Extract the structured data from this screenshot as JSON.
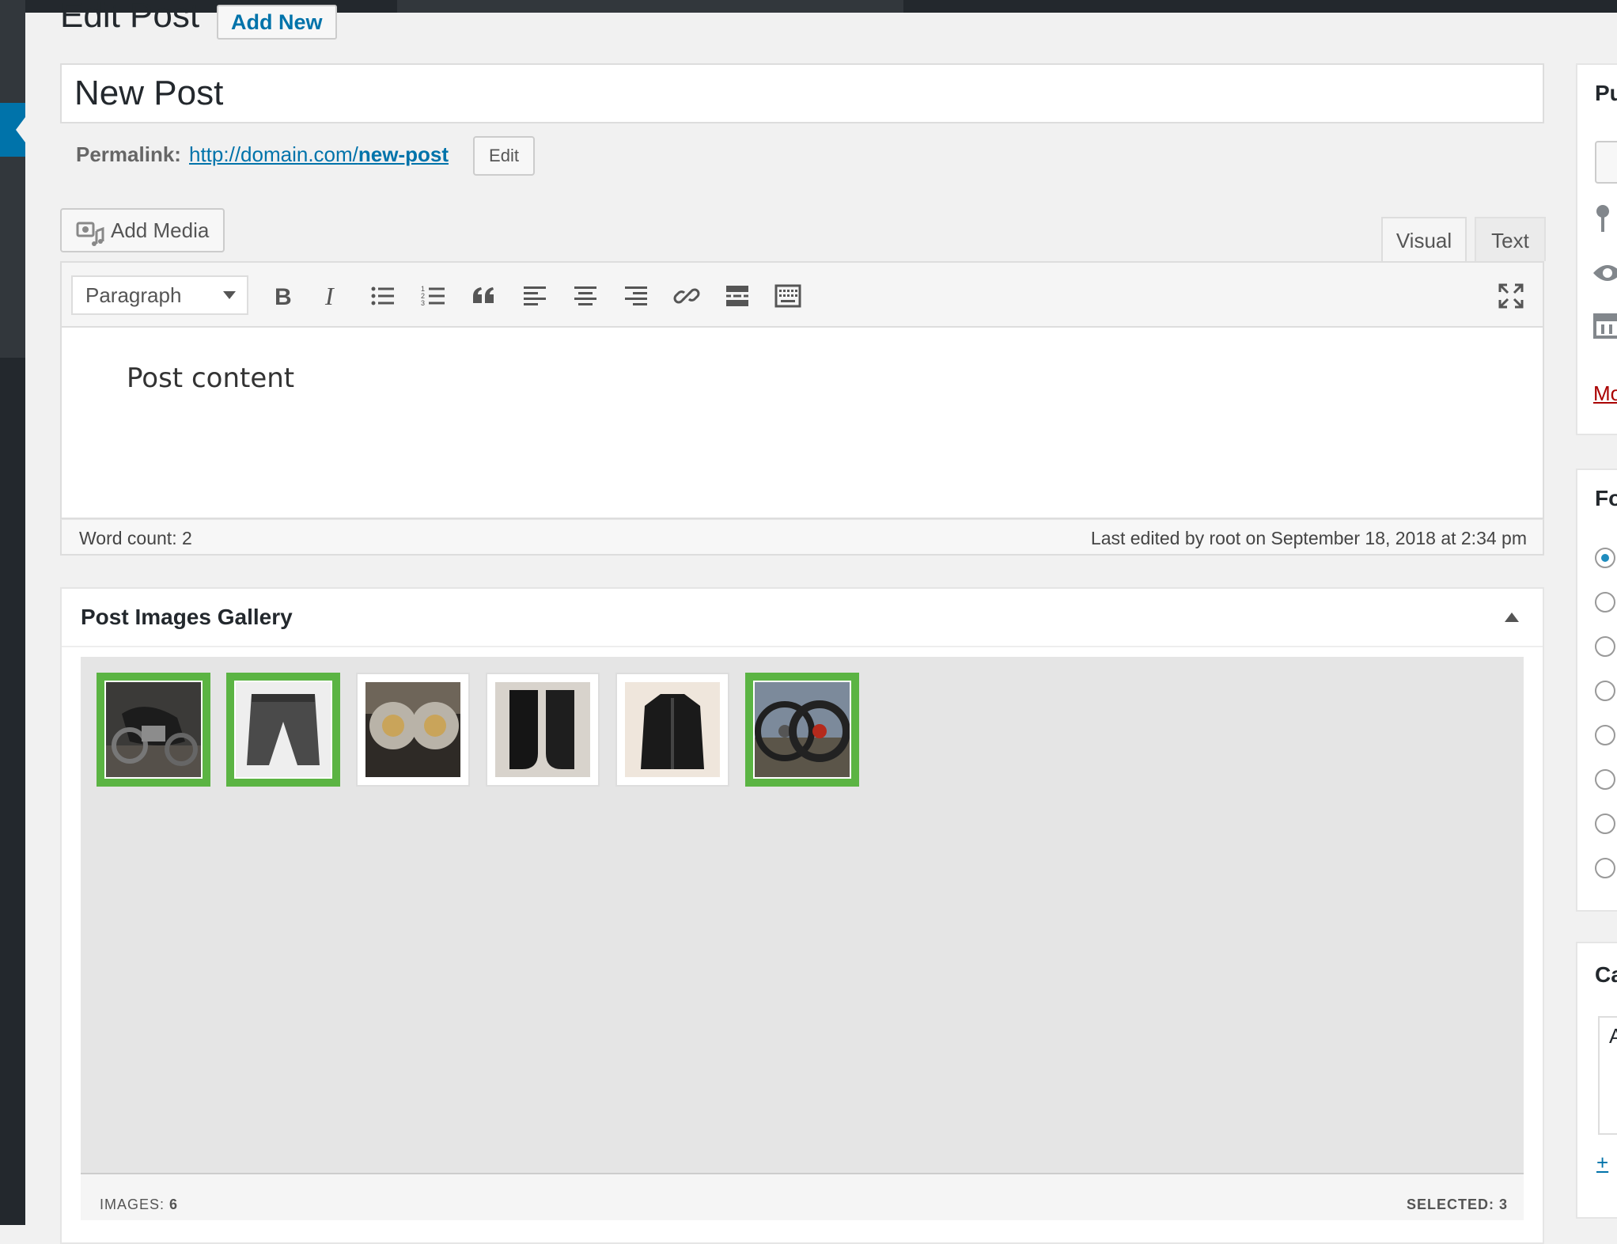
{
  "page": {
    "title": "Edit Post",
    "add_new_label": "Add New"
  },
  "post": {
    "title": "New Post",
    "permalink_label": "Permalink:",
    "permalink_base": "http://domain.com/",
    "permalink_slug": "new-post",
    "permalink_edit_label": "Edit"
  },
  "editor": {
    "add_media_label": "Add Media",
    "tabs": {
      "visual": "Visual",
      "text": "Text"
    },
    "format_select": "Paragraph",
    "toolbar": [
      "bold-icon",
      "italic-icon",
      "bulleted-list-icon",
      "numbered-list-icon",
      "blockquote-icon",
      "align-left-icon",
      "align-center-icon",
      "align-right-icon",
      "link-icon",
      "read-more-icon",
      "toolbar-toggle-icon",
      "fullscreen-icon"
    ],
    "content": "Post content",
    "word_count": "Word count: 2",
    "last_edited": "Last edited by root on September 18, 2018 at 2:34 pm"
  },
  "gallery": {
    "title": "Post Images Gallery",
    "images_label": "IMAGES:",
    "images_count": "6",
    "selected_label": "SELECTED:",
    "selected_count": "3",
    "items": [
      {
        "name": "motorcycle",
        "selected": true
      },
      {
        "name": "trousers",
        "selected": true
      },
      {
        "name": "brake-discs",
        "selected": false
      },
      {
        "name": "boots",
        "selected": false
      },
      {
        "name": "jacket",
        "selected": false
      },
      {
        "name": "wheels",
        "selected": true
      }
    ]
  },
  "sidebar": {
    "publish_title": "Pu",
    "move_trash_label": "Mo",
    "format_title": "Fo",
    "categories_title": "Ca",
    "categories_tab": "A",
    "add_category_label": "+"
  },
  "colors": {
    "admin_bar": "#23282d",
    "accent": "#0073aa",
    "selected_border": "#5bb443",
    "trash_link": "#a00"
  }
}
